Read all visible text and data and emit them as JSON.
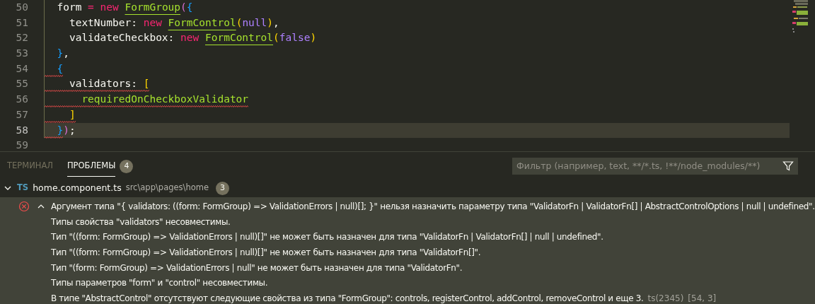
{
  "editor": {
    "lines": [
      {
        "number": "50",
        "current": false,
        "tokens": [
          {
            "text": "  form ",
            "kind": "plain"
          },
          {
            "text": "= new ",
            "kind": "keyword"
          },
          {
            "text": "FormGroup",
            "kind": "class"
          },
          {
            "text": "(",
            "kind": "paren"
          },
          {
            "text": "{",
            "kind": "brace"
          }
        ]
      },
      {
        "number": "51",
        "current": false,
        "tokens": [
          {
            "text": "    textNumber: ",
            "kind": "plain"
          },
          {
            "text": "new ",
            "kind": "keyword"
          },
          {
            "text": "FormControl",
            "kind": "class"
          },
          {
            "text": "(",
            "kind": "bracket"
          },
          {
            "text": "null",
            "kind": "constant"
          },
          {
            "text": ")",
            "kind": "bracket"
          },
          {
            "text": ",",
            "kind": "plain"
          }
        ]
      },
      {
        "number": "52",
        "current": false,
        "tokens": [
          {
            "text": "    validateCheckbox: ",
            "kind": "plain"
          },
          {
            "text": "new ",
            "kind": "keyword"
          },
          {
            "text": "FormControl",
            "kind": "class"
          },
          {
            "text": "(",
            "kind": "bracket"
          },
          {
            "text": "false",
            "kind": "constant"
          },
          {
            "text": ")",
            "kind": "bracket"
          }
        ]
      },
      {
        "number": "53",
        "current": false,
        "tokens": [
          {
            "text": "  }",
            "kind": "brace"
          },
          {
            "text": ",",
            "kind": "plain"
          }
        ]
      },
      {
        "number": "54",
        "current": false,
        "tokens": [
          {
            "text": "  {",
            "kind": "brace",
            "squiggle": true
          }
        ]
      },
      {
        "number": "55",
        "current": false,
        "tokens": [
          {
            "text": "    validators: ",
            "kind": "plain",
            "squiggle": true
          },
          {
            "text": "[",
            "kind": "bracket",
            "squiggle": true
          }
        ]
      },
      {
        "number": "56",
        "current": false,
        "tokens": [
          {
            "text": "      requiredOnCheckboxValidator",
            "kind": "function",
            "squiggle": true
          }
        ]
      },
      {
        "number": "57",
        "current": false,
        "tokens": [
          {
            "text": "    ]",
            "kind": "bracket",
            "squiggle": true
          }
        ]
      },
      {
        "number": "58",
        "current": true,
        "tokens": [
          {
            "text": "  }",
            "kind": "brace",
            "squiggle": true
          },
          {
            "text": ")",
            "kind": "paren"
          },
          {
            "text": ";",
            "kind": "plain"
          }
        ]
      },
      {
        "number": "59",
        "current": false
      }
    ]
  },
  "panel": {
    "tabs": [
      {
        "label": "ТЕРМИНАЛ",
        "selected": false
      },
      {
        "label": "ПРОБЛЕМЫ",
        "selected": true,
        "count": "4"
      }
    ],
    "filter": {
      "placeholder": "Фильтр (например, text, **/*.ts, !**/node_modules/**)"
    },
    "file": {
      "expanded": true,
      "badge": "TS",
      "name": "home.component.ts",
      "path": "src\\app\\pages\\home",
      "count": "3"
    },
    "messages": [
      {
        "kind": "error",
        "text": "Аргумент типа \"{ validators: ((form: FormGroup) => ValidationErrors | null)[]; }\" нельзя назначить параметру типа \"ValidatorFn | ValidatorFn[] | AbstractControlOptions | null | undefined\"."
      },
      {
        "kind": "detail",
        "text": "Типы свойства \"validators\" несовместимы."
      },
      {
        "kind": "detail",
        "text": "Тип \"((form: FormGroup) => ValidationErrors | null)[]\" не может быть назначен для типа \"ValidatorFn | ValidatorFn[] | null | undefined\"."
      },
      {
        "kind": "detail",
        "text": "Тип \"((form: FormGroup) => ValidationErrors | null)[]\" не может быть назначен для типа \"ValidatorFn[]\"."
      },
      {
        "kind": "detail",
        "text": "Тип \"(form: FormGroup) => ValidationErrors | null\" не может быть назначен для типа \"ValidatorFn\"."
      },
      {
        "kind": "detail",
        "text": "Типы параметров \"form\" и \"control\" несовместимы."
      },
      {
        "kind": "detail",
        "text": "В типе \"AbstractControl\" отсутствуют следующие свойства из типа \"FormGroup\": controls, registerControl, addControl, removeControl и еще 3.",
        "code": "ts(2345)",
        "position": "[54, 3]"
      }
    ]
  }
}
